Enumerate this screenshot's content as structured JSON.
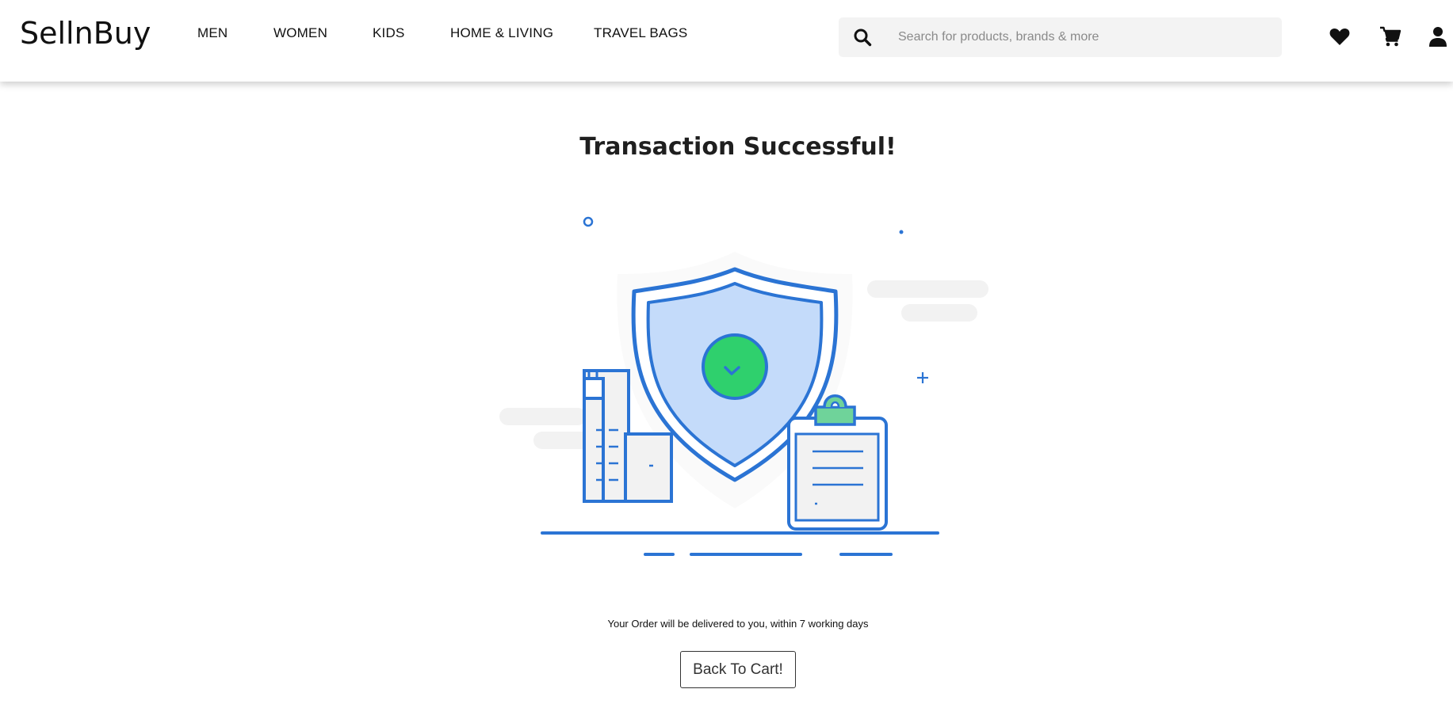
{
  "header": {
    "logo": "SellnBuy",
    "nav": [
      {
        "label": "MEN"
      },
      {
        "label": "WOMEN"
      },
      {
        "label": "KIDS"
      },
      {
        "label": "HOME & LIVING"
      },
      {
        "label": "TRAVEL BAGS"
      }
    ],
    "search": {
      "placeholder": "Search for products, brands & more",
      "value": ""
    },
    "icons": [
      "search-icon",
      "heart-icon",
      "cart-icon",
      "user-icon"
    ]
  },
  "main": {
    "title": "Transaction Successful!",
    "illustration": "shield-checkmark-with-buildings-and-clipboard",
    "message": "Your Order will be delivered to you, within 7 working days",
    "button_label": "Back To Cart!"
  },
  "colors": {
    "accent_blue": "#2b74d4",
    "shield_fill": "#c4dbfa",
    "success_green": "#2fd06d",
    "clipboard_clip": "#6fd39a",
    "cloud_gray": "#f2f2f2"
  }
}
